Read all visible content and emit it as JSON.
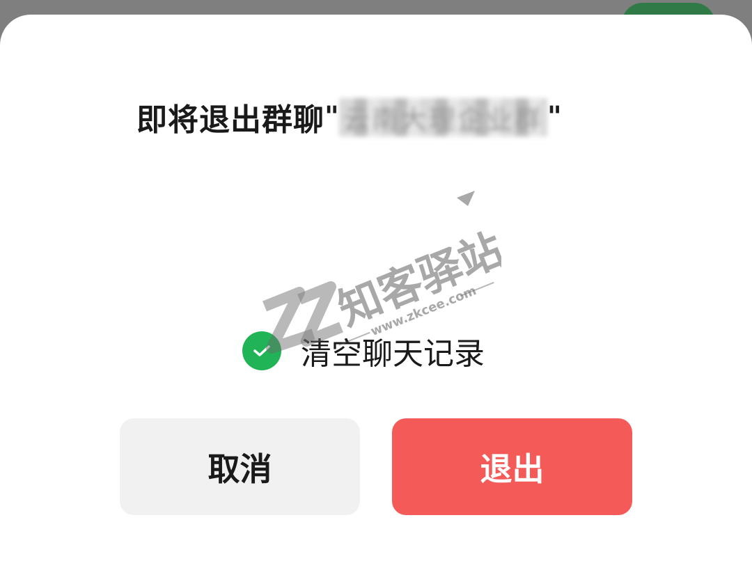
{
  "dialog": {
    "title_prefix": "即将退出群聊",
    "quote_open": "\"",
    "group_name": "云南大理企业群",
    "quote_close": "\"",
    "checkbox_label": "清空聊天记录",
    "checkbox_checked": true,
    "cancel_label": "取消",
    "exit_label": "退出"
  },
  "watermark": {
    "brand": "知客驿站",
    "url": "www.zkcee.com"
  },
  "colors": {
    "accent_green": "#20b457",
    "danger_red": "#f45a57",
    "cancel_bg": "#f1f1f1",
    "overlay": "#7f7f7f"
  }
}
